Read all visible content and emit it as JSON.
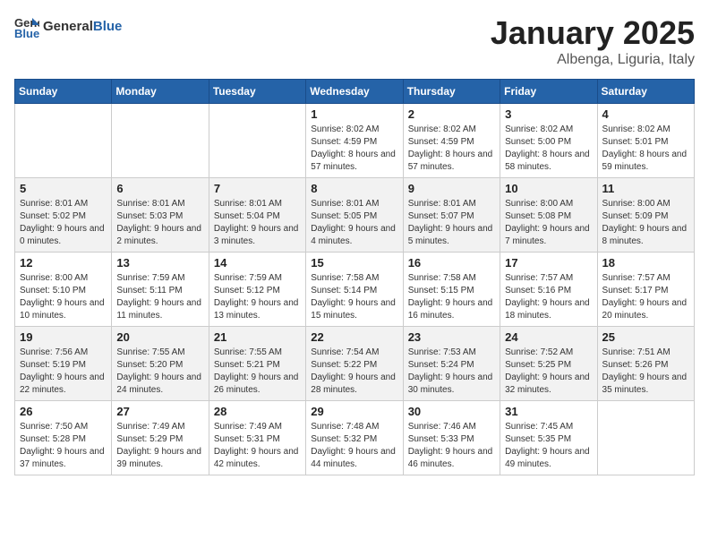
{
  "header": {
    "logo_general": "General",
    "logo_blue": "Blue",
    "title": "January 2025",
    "subtitle": "Albenga, Liguria, Italy"
  },
  "days_of_week": [
    "Sunday",
    "Monday",
    "Tuesday",
    "Wednesday",
    "Thursday",
    "Friday",
    "Saturday"
  ],
  "weeks": [
    [
      {
        "day": "",
        "info": ""
      },
      {
        "day": "",
        "info": ""
      },
      {
        "day": "",
        "info": ""
      },
      {
        "day": "1",
        "info": "Sunrise: 8:02 AM\nSunset: 4:59 PM\nDaylight: 8 hours and 57 minutes."
      },
      {
        "day": "2",
        "info": "Sunrise: 8:02 AM\nSunset: 4:59 PM\nDaylight: 8 hours and 57 minutes."
      },
      {
        "day": "3",
        "info": "Sunrise: 8:02 AM\nSunset: 5:00 PM\nDaylight: 8 hours and 58 minutes."
      },
      {
        "day": "4",
        "info": "Sunrise: 8:02 AM\nSunset: 5:01 PM\nDaylight: 8 hours and 59 minutes."
      }
    ],
    [
      {
        "day": "5",
        "info": "Sunrise: 8:01 AM\nSunset: 5:02 PM\nDaylight: 9 hours and 0 minutes."
      },
      {
        "day": "6",
        "info": "Sunrise: 8:01 AM\nSunset: 5:03 PM\nDaylight: 9 hours and 2 minutes."
      },
      {
        "day": "7",
        "info": "Sunrise: 8:01 AM\nSunset: 5:04 PM\nDaylight: 9 hours and 3 minutes."
      },
      {
        "day": "8",
        "info": "Sunrise: 8:01 AM\nSunset: 5:05 PM\nDaylight: 9 hours and 4 minutes."
      },
      {
        "day": "9",
        "info": "Sunrise: 8:01 AM\nSunset: 5:07 PM\nDaylight: 9 hours and 5 minutes."
      },
      {
        "day": "10",
        "info": "Sunrise: 8:00 AM\nSunset: 5:08 PM\nDaylight: 9 hours and 7 minutes."
      },
      {
        "day": "11",
        "info": "Sunrise: 8:00 AM\nSunset: 5:09 PM\nDaylight: 9 hours and 8 minutes."
      }
    ],
    [
      {
        "day": "12",
        "info": "Sunrise: 8:00 AM\nSunset: 5:10 PM\nDaylight: 9 hours and 10 minutes."
      },
      {
        "day": "13",
        "info": "Sunrise: 7:59 AM\nSunset: 5:11 PM\nDaylight: 9 hours and 11 minutes."
      },
      {
        "day": "14",
        "info": "Sunrise: 7:59 AM\nSunset: 5:12 PM\nDaylight: 9 hours and 13 minutes."
      },
      {
        "day": "15",
        "info": "Sunrise: 7:58 AM\nSunset: 5:14 PM\nDaylight: 9 hours and 15 minutes."
      },
      {
        "day": "16",
        "info": "Sunrise: 7:58 AM\nSunset: 5:15 PM\nDaylight: 9 hours and 16 minutes."
      },
      {
        "day": "17",
        "info": "Sunrise: 7:57 AM\nSunset: 5:16 PM\nDaylight: 9 hours and 18 minutes."
      },
      {
        "day": "18",
        "info": "Sunrise: 7:57 AM\nSunset: 5:17 PM\nDaylight: 9 hours and 20 minutes."
      }
    ],
    [
      {
        "day": "19",
        "info": "Sunrise: 7:56 AM\nSunset: 5:19 PM\nDaylight: 9 hours and 22 minutes."
      },
      {
        "day": "20",
        "info": "Sunrise: 7:55 AM\nSunset: 5:20 PM\nDaylight: 9 hours and 24 minutes."
      },
      {
        "day": "21",
        "info": "Sunrise: 7:55 AM\nSunset: 5:21 PM\nDaylight: 9 hours and 26 minutes."
      },
      {
        "day": "22",
        "info": "Sunrise: 7:54 AM\nSunset: 5:22 PM\nDaylight: 9 hours and 28 minutes."
      },
      {
        "day": "23",
        "info": "Sunrise: 7:53 AM\nSunset: 5:24 PM\nDaylight: 9 hours and 30 minutes."
      },
      {
        "day": "24",
        "info": "Sunrise: 7:52 AM\nSunset: 5:25 PM\nDaylight: 9 hours and 32 minutes."
      },
      {
        "day": "25",
        "info": "Sunrise: 7:51 AM\nSunset: 5:26 PM\nDaylight: 9 hours and 35 minutes."
      }
    ],
    [
      {
        "day": "26",
        "info": "Sunrise: 7:50 AM\nSunset: 5:28 PM\nDaylight: 9 hours and 37 minutes."
      },
      {
        "day": "27",
        "info": "Sunrise: 7:49 AM\nSunset: 5:29 PM\nDaylight: 9 hours and 39 minutes."
      },
      {
        "day": "28",
        "info": "Sunrise: 7:49 AM\nSunset: 5:31 PM\nDaylight: 9 hours and 42 minutes."
      },
      {
        "day": "29",
        "info": "Sunrise: 7:48 AM\nSunset: 5:32 PM\nDaylight: 9 hours and 44 minutes."
      },
      {
        "day": "30",
        "info": "Sunrise: 7:46 AM\nSunset: 5:33 PM\nDaylight: 9 hours and 46 minutes."
      },
      {
        "day": "31",
        "info": "Sunrise: 7:45 AM\nSunset: 5:35 PM\nDaylight: 9 hours and 49 minutes."
      },
      {
        "day": "",
        "info": ""
      }
    ]
  ]
}
